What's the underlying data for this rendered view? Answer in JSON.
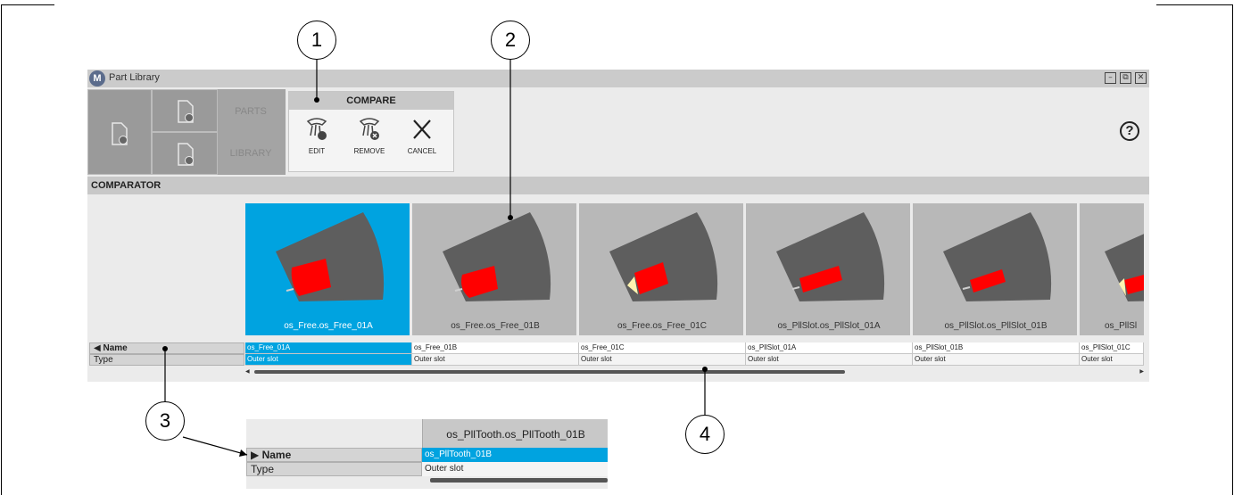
{
  "window": {
    "title": "Part Library",
    "logo": "M"
  },
  "window_controls": {
    "minimize": "–",
    "restore": "⧉",
    "close": "✕"
  },
  "ribbon": {
    "parts_label": "PARTS",
    "library_label": "LIBRARY",
    "compare": {
      "heading": "COMPARE",
      "edit_label": "EDIT",
      "remove_label": "REMOVE",
      "cancel_label": "CANCEL"
    },
    "help_symbol": "?"
  },
  "comparator": {
    "heading": "COMPARATOR",
    "row_labels": {
      "name": "◀ Name",
      "type": "Type"
    },
    "cards": [
      {
        "title": "os_Free.os_Free_01A",
        "name": "os_Free_01A",
        "type": "Outer slot",
        "selected": true
      },
      {
        "title": "os_Free.os_Free_01B",
        "name": "os_Free_01B",
        "type": "Outer slot",
        "selected": false
      },
      {
        "title": "os_Free.os_Free_01C",
        "name": "os_Free_01C",
        "type": "Outer slot",
        "selected": false
      },
      {
        "title": "os_PllSlot.os_PllSlot_01A",
        "name": "os_PllSlot_01A",
        "type": "Outer slot",
        "selected": false
      },
      {
        "title": "os_PllSlot.os_PllSlot_01B",
        "name": "os_PllSlot_01B",
        "type": "Outer slot",
        "selected": false
      },
      {
        "title": "os_PllSl",
        "name": "os_PllSlot_01C",
        "type": "Outer slot",
        "selected": false
      }
    ],
    "scroll_left": "◀",
    "scroll_right": "▶"
  },
  "callouts": [
    "1",
    "2",
    "3",
    "4"
  ],
  "inset": {
    "card_title": "os_PllTooth.os_PllTooth_01B",
    "name_label": "▶ Name",
    "type_label": "Type",
    "name_value": "os_PllTooth_01B",
    "type_value": "Outer slot"
  },
  "colors": {
    "selection": "#00a3e0",
    "tile": "#9a9a9a",
    "slot_fill": "#ff0000",
    "stator": "#5e5e5e"
  }
}
